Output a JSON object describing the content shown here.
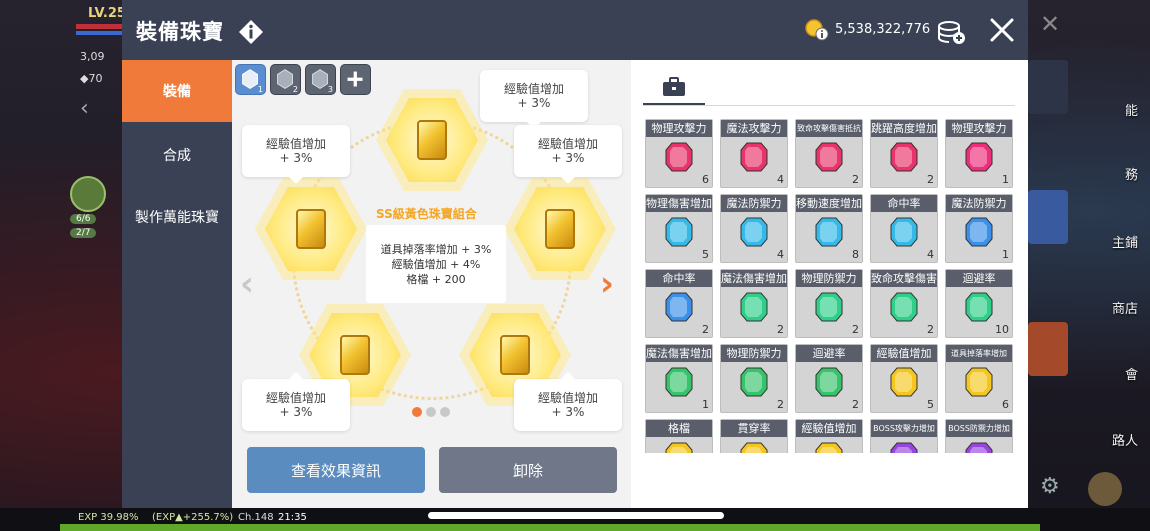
{
  "background": {
    "level": "LV.25",
    "stat_1": "3,09",
    "stat_2": "◆70",
    "pill_1": "6/6",
    "pill_2": "2/7",
    "right_labels": [
      "能",
      "務",
      "主鋪",
      "商店",
      "會",
      "路人"
    ],
    "exp_text": "EXP 39.98%",
    "exp_gain": "(EXP▲+255.7%)",
    "channel": "Ch.148",
    "clock": "21:35"
  },
  "header": {
    "title": "裝備珠寶",
    "coin_value": "5,538,322,776"
  },
  "sidebar": {
    "items": [
      {
        "label": "裝備",
        "active": true
      },
      {
        "label": "合成",
        "active": false
      },
      {
        "label": "製作萬能珠寶",
        "active": false
      }
    ]
  },
  "set_tabs": [
    {
      "num": "1",
      "active": true
    },
    {
      "num": "2",
      "active": false
    },
    {
      "num": "3",
      "active": false
    }
  ],
  "add_tab_icon": "plus-icon",
  "slots": [
    {
      "line1": "經驗值增加",
      "line2": "+ 3%"
    },
    {
      "line1": "經驗值增加",
      "line2": "+ 3%"
    },
    {
      "line1": "經驗值增加",
      "line2": "+ 3%"
    },
    {
      "line1": "經驗值增加",
      "line2": "+ 3%"
    },
    {
      "line1": "經驗值增加",
      "line2": "+ 3%"
    },
    {
      "line1": "經驗值增加",
      "line2": "+ 3%"
    }
  ],
  "combo": {
    "title": "SS級黃色珠寶組合",
    "lines": [
      "道具掉落率增加 + 3%",
      "經驗值增加 + 4%",
      "格檔 + 200"
    ]
  },
  "pagination": {
    "total": 3,
    "current": 1
  },
  "buttons": {
    "view_effects": "查看效果資訊",
    "unequip": "卸除"
  },
  "inventory": {
    "tab_icon": "briefcase-icon",
    "gems": [
      {
        "label": "物理攻擊力",
        "color": "#e8336b",
        "count": "6",
        "small": false
      },
      {
        "label": "魔法攻擊力",
        "color": "#e8336b",
        "count": "4",
        "small": false
      },
      {
        "label": "致命攻擊傷害抵抗",
        "color": "#e8336b",
        "count": "2",
        "small": true
      },
      {
        "label": "跳躍高度增加",
        "color": "#e8336b",
        "count": "2",
        "small": false
      },
      {
        "label": "物理攻擊力",
        "color": "#ef2d7a",
        "count": "1",
        "small": false
      },
      {
        "label": "物理傷害增加",
        "color": "#35b9e8",
        "count": "5",
        "small": false
      },
      {
        "label": "魔法防禦力",
        "color": "#35b9e8",
        "count": "4",
        "small": false
      },
      {
        "label": "移動速度增加",
        "color": "#35b9e8",
        "count": "8",
        "small": false
      },
      {
        "label": "命中率",
        "color": "#35b9e8",
        "count": "4",
        "small": false
      },
      {
        "label": "魔法防禦力",
        "color": "#3a8fe8",
        "count": "1",
        "small": false
      },
      {
        "label": "命中率",
        "color": "#3a8fe8",
        "count": "2",
        "small": false
      },
      {
        "label": "魔法傷害增加",
        "color": "#2fcf8a",
        "count": "2",
        "small": false
      },
      {
        "label": "物理防禦力",
        "color": "#2fcf8a",
        "count": "2",
        "small": false
      },
      {
        "label": "致命攻擊傷害",
        "color": "#2fcf8a",
        "count": "2",
        "small": false
      },
      {
        "label": "迴避率",
        "color": "#2fcf8a",
        "count": "10",
        "small": false
      },
      {
        "label": "魔法傷害增加",
        "color": "#36c46a",
        "count": "1",
        "small": false
      },
      {
        "label": "物理防禦力",
        "color": "#36c46a",
        "count": "2",
        "small": false
      },
      {
        "label": "迴避率",
        "color": "#36c46a",
        "count": "2",
        "small": false
      },
      {
        "label": "經驗值增加",
        "color": "#f5c620",
        "count": "5",
        "small": false
      },
      {
        "label": "道具掉落率增加",
        "color": "#f5c620",
        "count": "6",
        "small": true
      },
      {
        "label": "格檔",
        "color": "#f5c620",
        "count": "",
        "small": false
      },
      {
        "label": "貫穿率",
        "color": "#f5c620",
        "count": "",
        "small": false
      },
      {
        "label": "經驗值增加",
        "color": "#f5c620",
        "count": "",
        "small": false
      },
      {
        "label": "BOSS攻擊力增加",
        "color": "#9a44e0",
        "count": "",
        "small": true
      },
      {
        "label": "BOSS防禦力增加",
        "color": "#9a44e0",
        "count": "",
        "small": true
      }
    ]
  },
  "colors": {
    "header": "#3a4154",
    "active_orange": "#f07a3a",
    "button_blue": "#5a8cc0",
    "button_slate": "#6f7789"
  }
}
